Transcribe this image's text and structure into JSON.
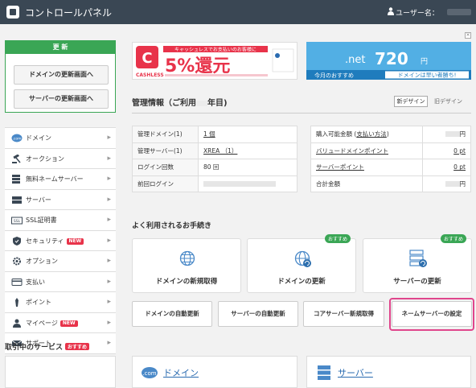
{
  "header": {
    "title": "コントロールパネル",
    "user_label": "ユーザー名："
  },
  "update_box": {
    "heading": "更 新",
    "domain_button": "ドメインの更新画面へ",
    "server_button": "サーバーの更新画面へ"
  },
  "sidebar": {
    "items": [
      {
        "label": "ドメイン",
        "icon": "dotcom-icon",
        "new": false
      },
      {
        "label": "オークション",
        "icon": "gavel-icon",
        "new": false
      },
      {
        "label": "無料ネームサーバー",
        "icon": "server-stack-icon",
        "new": false
      },
      {
        "label": "サーバー",
        "icon": "server-icon",
        "new": false
      },
      {
        "label": "SSL証明書",
        "icon": "ssl-icon",
        "new": false
      },
      {
        "label": "セキュリティ",
        "icon": "shield-icon",
        "new": true
      },
      {
        "label": "オプション",
        "icon": "gear-icon",
        "new": false
      },
      {
        "label": "支払い",
        "icon": "card-icon",
        "new": false
      },
      {
        "label": "ポイント",
        "icon": "point-icon",
        "new": false
      },
      {
        "label": "マイページ",
        "icon": "person-icon",
        "new": true
      },
      {
        "label": "サポート",
        "icon": "mail-icon",
        "new": false
      }
    ],
    "new_badge": "NEW",
    "services_title": "取引中のサービス",
    "services_badge": "おすすめ"
  },
  "banners": {
    "left": {
      "headline": "5%還元",
      "tagline": "キャッシュレスでお支払いのお客様に",
      "brand": "CASHLESS"
    },
    "right": {
      "domain": ".net",
      "price": "720",
      "unit": "円",
      "today": "今月のおすすめ",
      "cta": "ドメインは早い者勝ち!"
    },
    "close": "×"
  },
  "panel": {
    "title": "管理情報（ご利用",
    "title_suffix": "年目)",
    "new_design": "新デザイン",
    "old_design": "旧デザイン"
  },
  "info_left": [
    {
      "key": "管理ドメイン(1)",
      "value": "1 個",
      "link": true
    },
    {
      "key": "管理サーバー(1)",
      "value": "XREA （1）",
      "link": true
    },
    {
      "key": "ログイン回数",
      "value": "80 回",
      "link": false
    },
    {
      "key": "前回ログイン",
      "value": "",
      "link": false
    }
  ],
  "info_right": [
    {
      "key": "購入可能金額 (",
      "key_link": "支払い方法",
      "key_end": ")",
      "value": "円",
      "link": false
    },
    {
      "key": "",
      "key_link": "バリュードメインポイント",
      "key_end": "",
      "value": "0 pt",
      "link": true
    },
    {
      "key": "",
      "key_link": "サーバーポイント",
      "key_end": "",
      "value": "0 pt",
      "link": true
    },
    {
      "key": "合計金額",
      "key_link": "",
      "key_end": "",
      "value": "円",
      "link": false
    }
  ],
  "procedures": {
    "title": "よく利用されるお手続き",
    "cards": [
      {
        "label": "ドメインの新規取得",
        "icon": "globe-icon",
        "badge": ""
      },
      {
        "label": "ドメインの更新",
        "icon": "globe-refresh-icon",
        "badge": "おすすめ"
      },
      {
        "label": "サーバーの更新",
        "icon": "server-refresh-icon",
        "badge": "おすすめ"
      }
    ],
    "small_buttons": [
      "ドメインの自動更新",
      "サーバーの自動更新",
      "コアサーバー新規取得",
      "ネームサーバーの設定"
    ]
  },
  "bottom_cards": [
    {
      "label": "ドメイン",
      "icon": "dotcom-icon"
    },
    {
      "label": "サーバー",
      "icon": "server-stack-icon"
    }
  ],
  "colors": {
    "header_bg": "#3a4754",
    "accent_green": "#3aa655",
    "new_red": "#e8334a",
    "highlight": "#e0468c",
    "link_blue": "#2a6bb0"
  }
}
